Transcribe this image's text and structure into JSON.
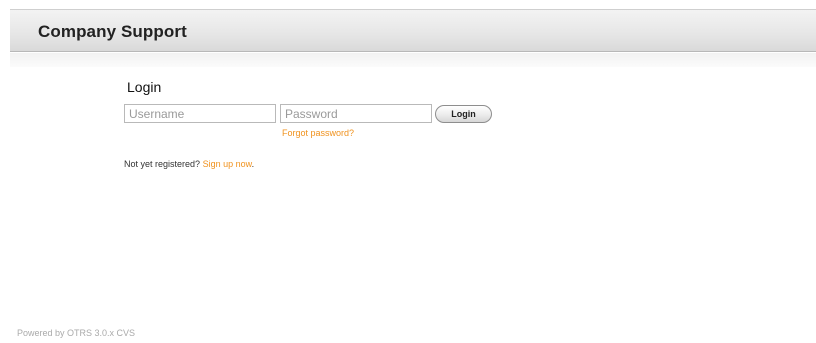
{
  "header": {
    "title": "Company Support"
  },
  "login": {
    "heading": "Login",
    "username_placeholder": "Username",
    "password_placeholder": "Password",
    "login_button": "Login",
    "forgot_password": "Forgot password?",
    "register_prompt": "Not yet registered?",
    "signup_link": "Sign up now",
    "signup_suffix": "."
  },
  "footer": {
    "text": "Powered by OTRS 3.0.x CVS"
  },
  "colors": {
    "link": "#f0921e",
    "header_text": "#222222"
  }
}
